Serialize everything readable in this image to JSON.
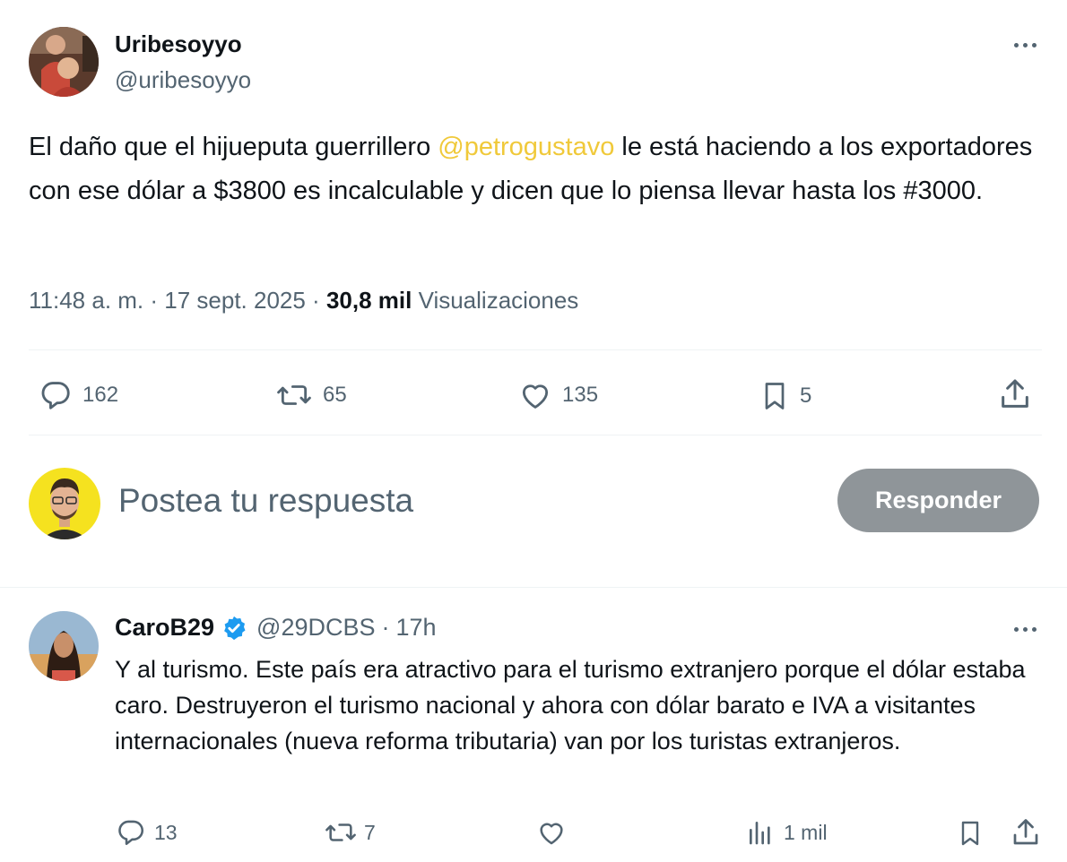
{
  "tweet": {
    "display_name": "Uribesoyyo",
    "handle": "@uribesoyyo",
    "text_before": "El daño que el hijueputa guerrillero ",
    "mention": "@petrogustavo",
    "text_after": " le está haciendo a los exportadores con ese dólar a $3800 es incalculable y dicen que lo piensa llevar hasta los #3000.",
    "timestamp": "11:48 a. m. · 17 sept. 2025 · ",
    "views_count": "30,8 mil",
    "views_label": " Visualizaciones",
    "replies": "162",
    "reposts": "65",
    "likes": "135",
    "bookmarks": "5",
    "mention_color": "#f0c93a"
  },
  "compose": {
    "placeholder": "Postea tu respuesta",
    "button_label": "Responder"
  },
  "reply": {
    "display_name": "CaroB29",
    "handle": "@29DCBS",
    "separator": "·",
    "time": "17h",
    "text": "Y al turismo. Este país era atractivo para el turismo extranjero porque el dólar estaba caro. Destruyeron el turismo nacional y ahora con dólar barato e IVA a visitantes  internacionales (nueva reforma tributaria) van  por los turistas extranjeros.",
    "replies": "13",
    "reposts": "7",
    "views": "1 mil",
    "verified_color": "#1d9bf0"
  },
  "icons": [
    "more-icon",
    "reply-icon",
    "repost-icon",
    "like-icon",
    "bookmark-icon",
    "share-icon",
    "views-icon",
    "verified-badge-icon"
  ]
}
